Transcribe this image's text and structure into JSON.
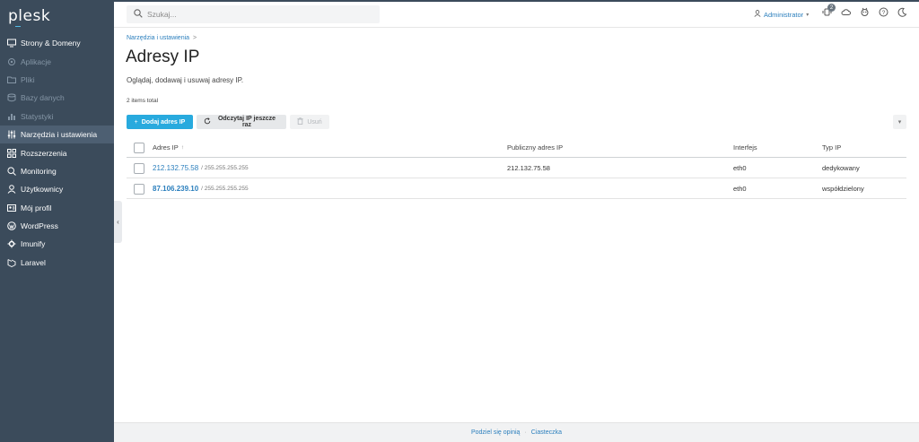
{
  "brand": {
    "logo_text": "plesk"
  },
  "sidebar": {
    "items": [
      {
        "label": "Strony & Domeny",
        "icon": "monitor-icon",
        "state": "normal"
      },
      {
        "label": "Aplikacje",
        "icon": "gear-icon",
        "state": "disabled"
      },
      {
        "label": "Pliki",
        "icon": "folder-icon",
        "state": "disabled"
      },
      {
        "label": "Bazy danych",
        "icon": "database-icon",
        "state": "disabled"
      },
      {
        "label": "Statystyki",
        "icon": "chart-icon",
        "state": "disabled"
      },
      {
        "label": "Narzędzia i ustawienia",
        "icon": "sliders-icon",
        "state": "active"
      },
      {
        "label": "Rozszerzenia",
        "icon": "grid-icon",
        "state": "normal"
      },
      {
        "label": "Monitoring",
        "icon": "monitoring-icon",
        "state": "normal"
      },
      {
        "label": "Użytkownicy",
        "icon": "user-icon",
        "state": "normal"
      },
      {
        "label": "Mój profil",
        "icon": "profile-icon",
        "state": "normal"
      },
      {
        "label": "WordPress",
        "icon": "wordpress-icon",
        "state": "normal"
      },
      {
        "label": "Imunify",
        "icon": "imunify-icon",
        "state": "normal"
      },
      {
        "label": "Laravel",
        "icon": "laravel-icon",
        "state": "normal"
      }
    ],
    "collapse_glyph": "‹"
  },
  "topbar": {
    "search_placeholder": "Szukaj...",
    "user_label": "Administrator",
    "notification_count": "2"
  },
  "main": {
    "breadcrumb": "Narzędzia i ustawienia",
    "breadcrumb_sep": ">",
    "title": "Adresy IP",
    "description": "Oglądaj, dodawaj i usuwaj adresy IP.",
    "total": "2 items total",
    "toolbar": {
      "add_label": "Dodaj adres IP",
      "reread_label": "Odczytaj IP jeszcze raz",
      "delete_label": "Usuń"
    },
    "table": {
      "headers": {
        "ip": "Adres IP",
        "public": "Publiczny adres IP",
        "interface": "Interfejs",
        "type": "Typ IP"
      },
      "rows": [
        {
          "ip": "212.132.75.58",
          "mask": "/ 255.255.255.255",
          "public": "212.132.75.58",
          "interface": "eth0",
          "type": "dedykowany"
        },
        {
          "ip": "87.106.239.10",
          "mask": "/ 255.255.255.255",
          "public": "",
          "interface": "eth0",
          "type": "współdzielony"
        }
      ]
    }
  },
  "footer": {
    "feedback": "Podziel się opinią",
    "sep": "·",
    "cookies": "Ciasteczka"
  },
  "colors": {
    "sidebar_bg": "#3b4b5b",
    "accent": "#28aade",
    "link": "#2b7fbd"
  }
}
